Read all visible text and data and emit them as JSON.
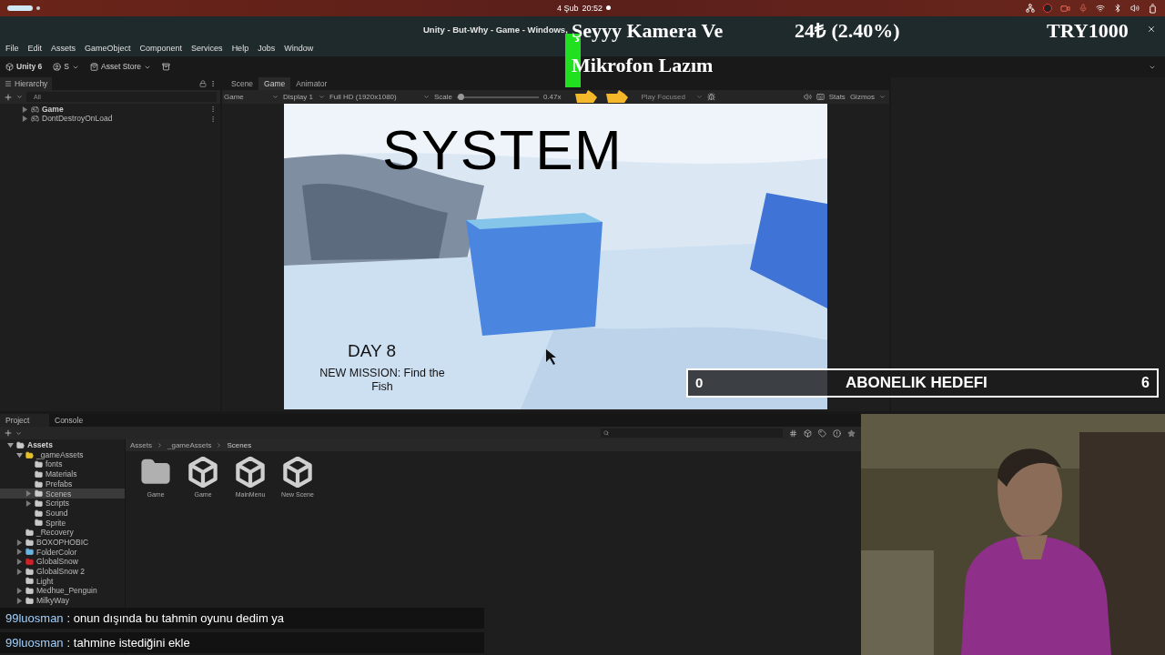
{
  "top_bar": {
    "date": "4 Şub",
    "time": "20:52"
  },
  "window": {
    "title": "Unity - But-Why - Game - Windows,"
  },
  "menu": [
    "File",
    "Edit",
    "Assets",
    "GameObject",
    "Component",
    "Services",
    "Help",
    "Jobs",
    "Window"
  ],
  "toolbar": {
    "product": "Unity 6",
    "account": "S",
    "store": "Asset Store"
  },
  "hierarchy": {
    "title": "Hierarchy",
    "search_placeholder": "All",
    "items": [
      {
        "name": "Game",
        "bold": true,
        "expanded": false
      },
      {
        "name": "DontDestroyOnLoad",
        "bold": false,
        "expanded": false
      }
    ]
  },
  "view_tabs": [
    {
      "label": "Scene",
      "selected": false
    },
    {
      "label": "Game",
      "selected": true
    },
    {
      "label": "Animator",
      "selected": false
    }
  ],
  "game_toolbar": {
    "view": "Game",
    "display": "Display 1",
    "resolution": "Full HD (1920x1080)",
    "scale_label": "Scale",
    "scale": {
      "level": 0.05
    },
    "scale_reading": "0.47x",
    "play_mode": "Play Focused",
    "stats": "Stats",
    "gizmos": "Gizmos"
  },
  "game_view": {
    "kind": "picture",
    "hud": {
      "title": "SYSTEM",
      "day": "DAY 8",
      "mission": "NEW MISSION: Find the Fish"
    }
  },
  "bottom_tabs": [
    {
      "label": "Project",
      "selected": true
    },
    {
      "label": "Console",
      "selected": false
    }
  ],
  "project": {
    "tree": [
      {
        "name": "Assets",
        "bold": true,
        "expanded": true,
        "selected": false,
        "color": "#c8c8c8",
        "children": [
          {
            "name": "_gameAssets",
            "bold": false,
            "expanded": true,
            "selected": false,
            "color": "#e6c229",
            "children": [
              {
                "name": "fonts",
                "bold": false,
                "selected": false,
                "color": "#c8c8c8"
              },
              {
                "name": "Materials",
                "bold": false,
                "selected": false,
                "color": "#c8c8c8"
              },
              {
                "name": "Prefabs",
                "bold": false,
                "selected": false,
                "color": "#c8c8c8"
              },
              {
                "name": "Scenes",
                "bold": false,
                "expanded": false,
                "selected": true,
                "color": "#c8c8c8"
              },
              {
                "name": "Scripts",
                "bold": false,
                "expanded": false,
                "selected": false,
                "color": "#c8c8c8"
              },
              {
                "name": "Sound",
                "bold": false,
                "selected": false,
                "color": "#c8c8c8"
              },
              {
                "name": "Sprite",
                "bold": false,
                "selected": false,
                "color": "#c8c8c8"
              }
            ]
          },
          {
            "name": "_Recovery",
            "bold": false,
            "selected": false,
            "color": "#c8c8c8"
          },
          {
            "name": "BOXOPHOBIC",
            "bold": false,
            "expanded": false,
            "selected": false,
            "color": "#c8c8c8"
          },
          {
            "name": "FolderColor",
            "bold": false,
            "expanded": false,
            "selected": false,
            "color": "#6ab4e0"
          },
          {
            "name": "GlobalSnow",
            "bold": false,
            "expanded": false,
            "selected": false,
            "color": "#d0202a"
          },
          {
            "name": "GlobalSnow 2",
            "bold": false,
            "expanded": false,
            "selected": false,
            "color": "#c8c8c8"
          },
          {
            "name": "Light",
            "bold": false,
            "selected": false,
            "color": "#c8c8c8"
          },
          {
            "name": "Medhue_Penguin",
            "bold": false,
            "expanded": false,
            "selected": false,
            "color": "#c8c8c8"
          },
          {
            "name": "MilkyWay",
            "bold": false,
            "expanded": false,
            "selected": false,
            "color": "#c8c8c8"
          }
        ]
      }
    ],
    "breadcrumb": [
      "Assets",
      "_gameAssets",
      "Scenes"
    ],
    "assets": [
      {
        "name": "Game",
        "kind": "folder"
      },
      {
        "name": "Game",
        "kind": "scene"
      },
      {
        "name": "MainMenu",
        "kind": "scene"
      },
      {
        "name": "New Scene",
        "kind": "scene"
      }
    ]
  },
  "overlays": {
    "camera_note": [
      "Şeyyy Kamera Ve",
      "Mikrofon Lazım"
    ],
    "donation": "24₺ (2.40%)",
    "goal_amount": "TRY1000",
    "subscription_goal": {
      "current": "0",
      "title": "ABONELIK HEDEFI",
      "target": "6"
    }
  },
  "chat": [
    {
      "user": "99luosman",
      "message": ": onun dışında bu tahmin oyunu dedim ya"
    },
    {
      "user": "99luosman",
      "message": ": tahmine istediğini ekle"
    }
  ]
}
